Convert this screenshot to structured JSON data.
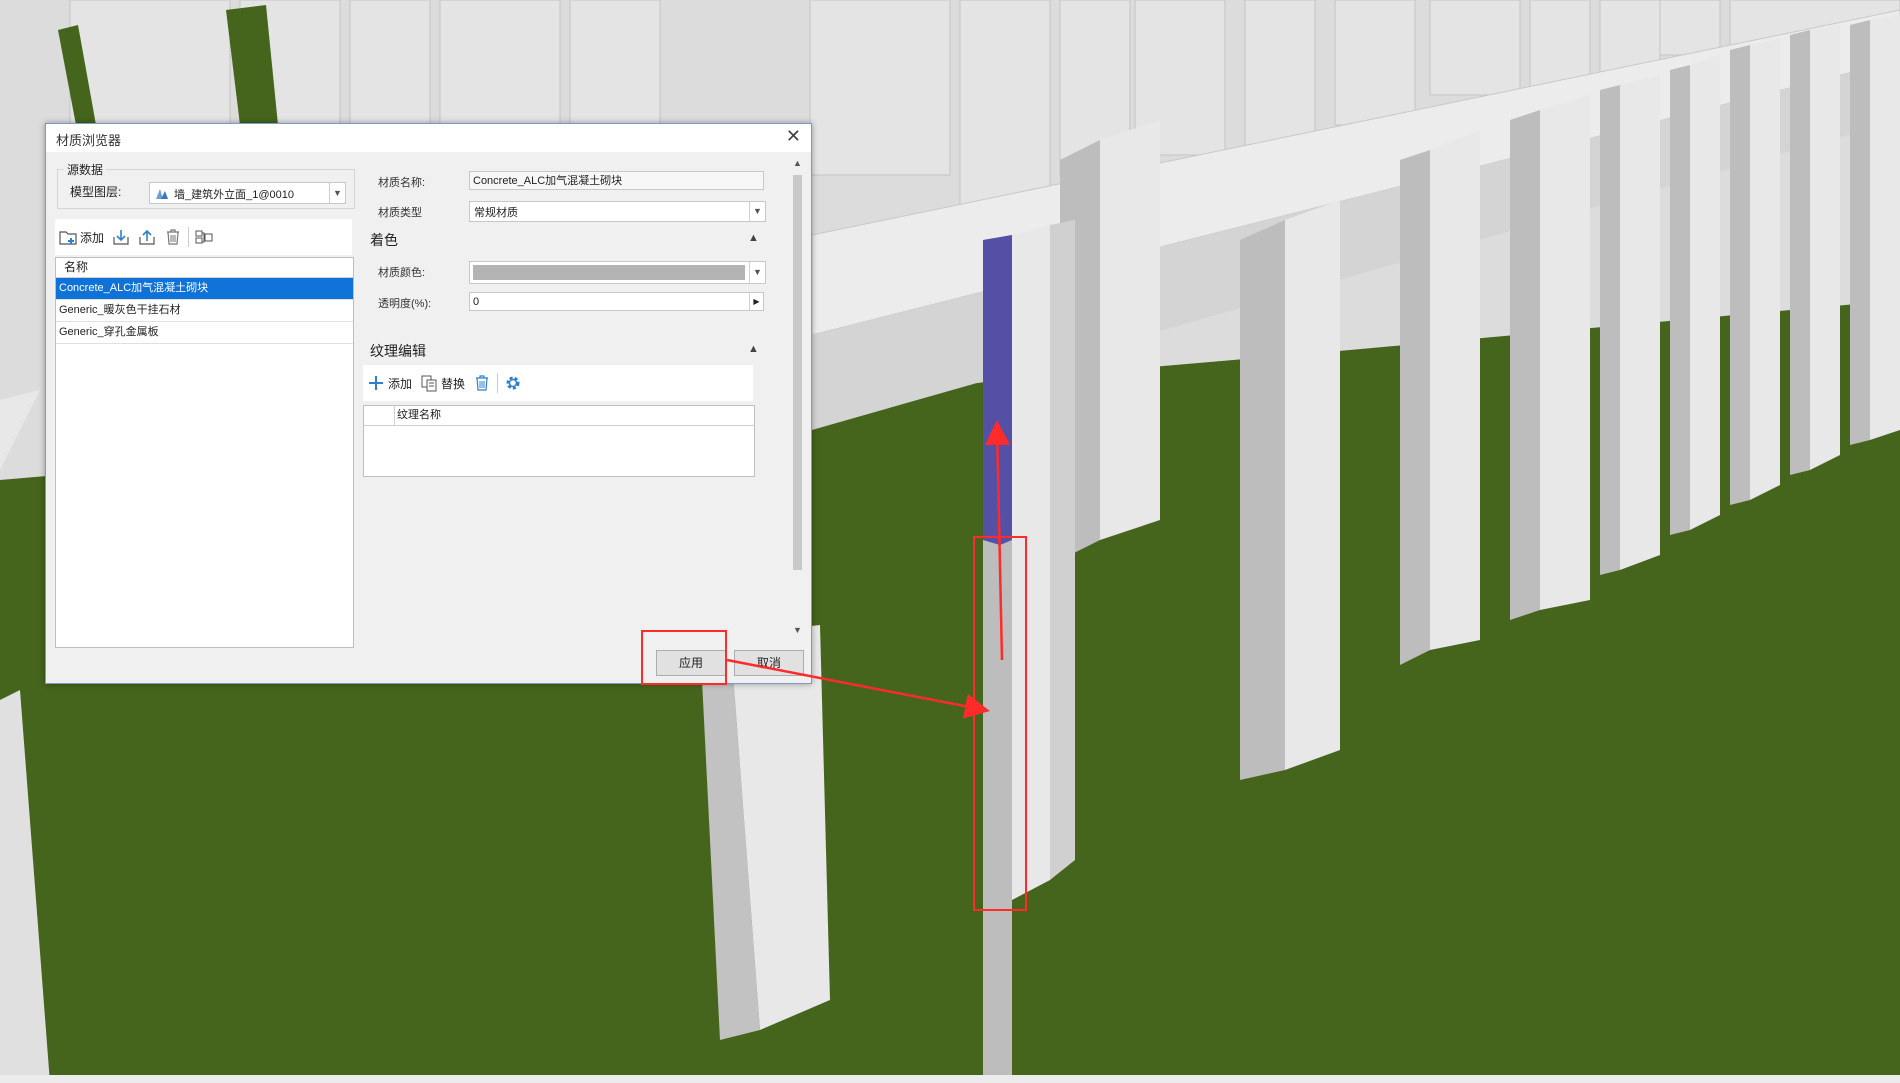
{
  "dialog": {
    "title": "材质浏览器",
    "close_glyph": "✕",
    "source": {
      "legend": "源数据",
      "layer_label": "模型图层:",
      "layer_value": "墙_建筑外立面_1@0010"
    },
    "list_toolbar": {
      "add_label": "添加"
    },
    "material_list": {
      "header": "名称",
      "items": [
        {
          "label": "Concrete_ALC加气混凝土砌块",
          "selected": true
        },
        {
          "label": "Generic_暖灰色干挂石材",
          "selected": false
        },
        {
          "label": "Generic_穿孔金属板",
          "selected": false
        }
      ]
    },
    "properties": {
      "name_label": "材质名称:",
      "name_value": "Concrete_ALC加气混凝土砌块",
      "type_label": "材质类型",
      "type_value": "常规材质"
    },
    "coloring": {
      "title": "着色",
      "color_label": "材质颜色:",
      "color_value": "#b4b4b4",
      "transparency_label": "透明度(%):",
      "transparency_value": "0"
    },
    "texture": {
      "title": "纹理编辑",
      "add_label": "添加",
      "replace_label": "替换",
      "column": "纹理名称"
    },
    "buttons": {
      "apply": "应用",
      "cancel": "取消"
    }
  },
  "colors": {
    "ground": "#45651c",
    "sky": "#d9d9d9",
    "selection": "#0f72d8",
    "highlighted_wall": "#5350a6",
    "annotation": "#ff2a2a",
    "icon_blue": "#2f7fcf"
  }
}
